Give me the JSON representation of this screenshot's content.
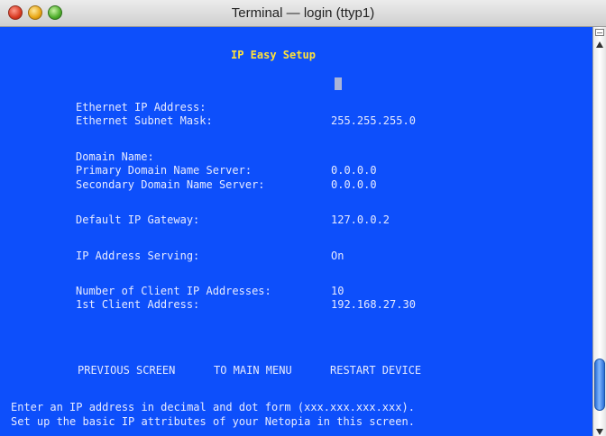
{
  "window": {
    "title": "Terminal — login (ttyp1)"
  },
  "screen": {
    "heading": "IP Easy Setup",
    "fields": {
      "ethernet_ip_label": "Ethernet IP Address:",
      "ethernet_ip_value": "",
      "subnet_label": "Ethernet Subnet Mask:",
      "subnet_value": "255.255.255.0",
      "domain_label": "Domain Name:",
      "domain_value": "",
      "primary_dns_label": "Primary Domain Name Server:",
      "primary_dns_value": "0.0.0.0",
      "secondary_dns_label": "Secondary Domain Name Server:",
      "secondary_dns_value": "0.0.0.0",
      "gateway_label": "Default IP Gateway:",
      "gateway_value": "127.0.0.2",
      "serving_label": "IP Address Serving:",
      "serving_value": "On",
      "num_clients_label": "Number of Client IP Addresses:",
      "num_clients_value": "10",
      "first_client_label": "1st Client Address:",
      "first_client_value": "192.168.27.30"
    },
    "actions": {
      "previous": "PREVIOUS SCREEN",
      "main_menu": "TO MAIN MENU",
      "restart": "RESTART DEVICE"
    },
    "help_line_1": "Enter an IP address in decimal and dot form (xxx.xxx.xxx.xxx).",
    "help_line_2": "Set up the basic IP attributes of your Netopia in this screen."
  },
  "colors": {
    "terminal_bg": "#0d4ffb",
    "terminal_text": "#e6eaff",
    "heading": "#ffe23a"
  },
  "icons": {
    "close": "close-icon",
    "minimize": "minimize-icon",
    "zoom": "zoom-icon",
    "split": "split-pane-icon",
    "scroll_up": "arrow-up-icon",
    "scroll_down": "arrow-down-icon"
  }
}
